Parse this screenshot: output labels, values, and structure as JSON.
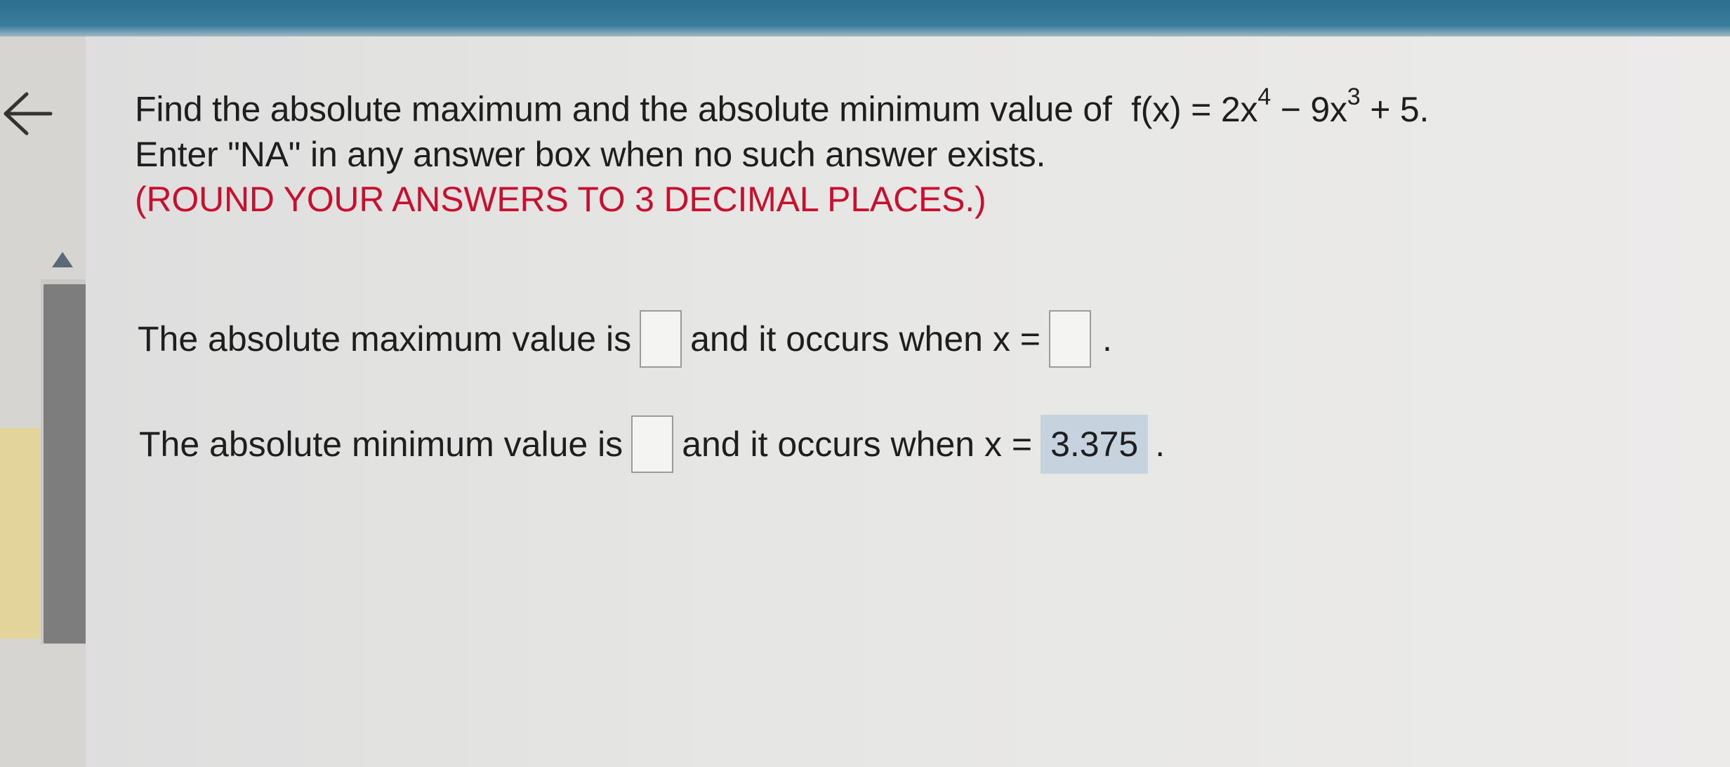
{
  "question": {
    "line1_prefix": "Find the absolute maximum and the absolute minimum value of",
    "func_lhs": "f(x) = 2x",
    "exp1": "4",
    "func_mid": " − 9x",
    "exp2": "3",
    "func_end": " + 5.",
    "line2": "Enter \"NA\" in any answer box when no such answer exists.",
    "line3": "(ROUND YOUR ANSWERS TO 3 DECIMAL PLACES.)"
  },
  "max_row": {
    "prefix": "The absolute maximum value is",
    "middle": "and it occurs when x =",
    "value": "",
    "x_value": "",
    "suffix": "."
  },
  "min_row": {
    "prefix": "The absolute minimum value is",
    "middle": "and it occurs when x =",
    "value": "",
    "x_value": "3.375",
    "suffix": "."
  },
  "colors": {
    "instruction_red": "#c8102e",
    "filled_box_bg": "#c6d3de",
    "top_bar": "#2c6f8f",
    "scroll_thumb": "#7d7d7d"
  },
  "icons": {
    "back": "back-arrow-icon",
    "scroll_up": "scroll-up-triangle-icon"
  }
}
